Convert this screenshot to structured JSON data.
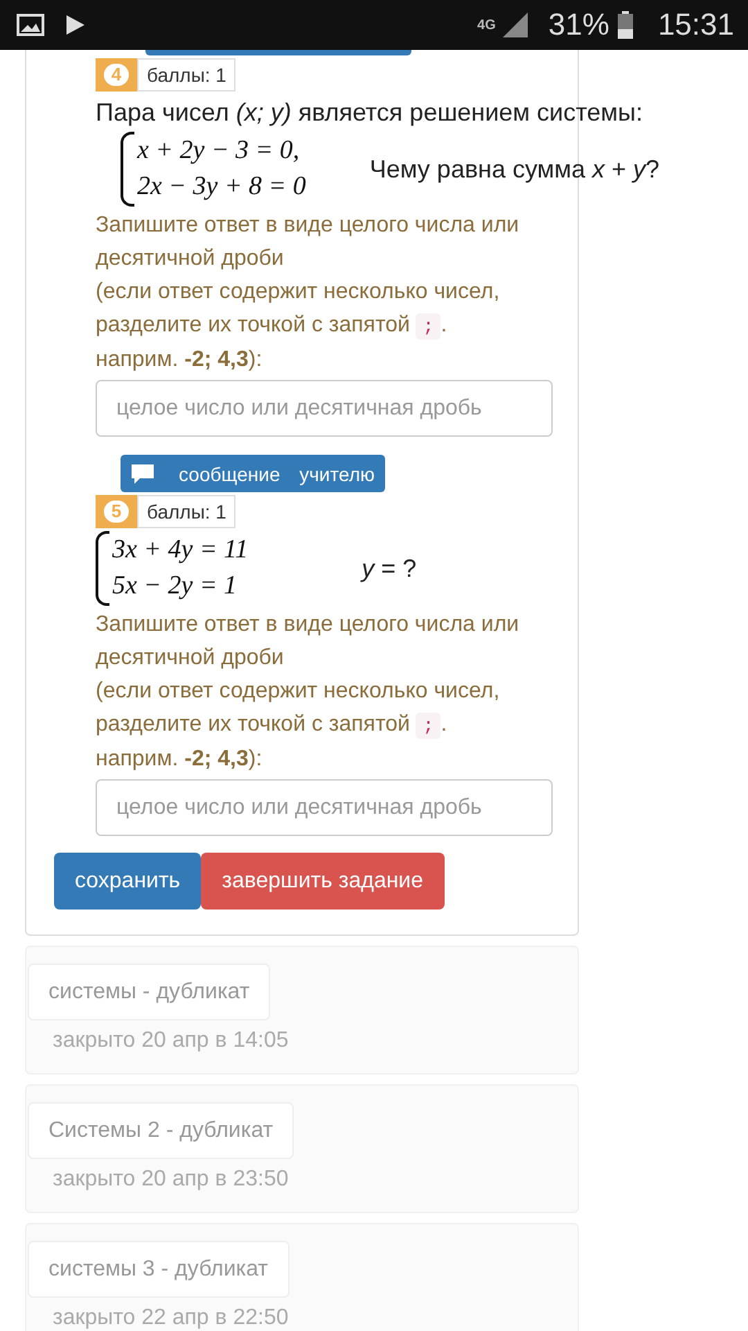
{
  "status_bar": {
    "network": "4G",
    "battery": "31%",
    "time": "15:31"
  },
  "questions": [
    {
      "number": "4",
      "points": "баллы: 1",
      "text": "Пара чисел *(x; y)* является решением системы:",
      "system": [
        "x + 2y − 3 = 0,",
        "2x − 3y + 8 = 0"
      ],
      "ask": "Чему равна сумма  *x* + *y*?",
      "hint": {
        "line_1": "Запишите ответ в виде целого числа или десятичной дроби",
        "line_2": "(если ответ содержит несколько чисел, разделите их точкой с запятой",
        "code": ";",
        "line_2_end": ".",
        "line_3": "наприм. **-2; 4,3**):"
      },
      "answer": {
        "placeholder": "целое число или десятичная дробь"
      }
    },
    {
      "message_button": "сообщение учителю",
      "number": "5",
      "points": "баллы: 1",
      "system": [
        "3x + 4y = 11",
        "5x − 2y = 1"
      ],
      "ask": "*y* = ?",
      "hint": {
        "line_1": "Запишите ответ в виде целого числа или десятичной дроби",
        "line_2": "(если ответ содержит несколько чисел, разделите их точкой с запятой",
        "code": ";",
        "line_2_end": ".",
        "line_3": "наприм. **-2; 4,3**):"
      },
      "answer": {
        "placeholder": "целое число или десятичная дробь"
      }
    }
  ],
  "actions": [
    {
      "label": "сохранить",
      "kind": "primary"
    },
    {
      "label": "завершить задание",
      "kind": "danger"
    }
  ],
  "assignments": [
    {
      "title": "системы - дубликат",
      "closed": "закрыто 20 апр в 14:05"
    },
    {
      "title": "Системы 2 - дубликат",
      "closed": "закрыто 20 апр в 23:50"
    },
    {
      "title": "системы 3 - дубликат",
      "closed": "закрыто 22 апр в 22:50"
    }
  ]
}
